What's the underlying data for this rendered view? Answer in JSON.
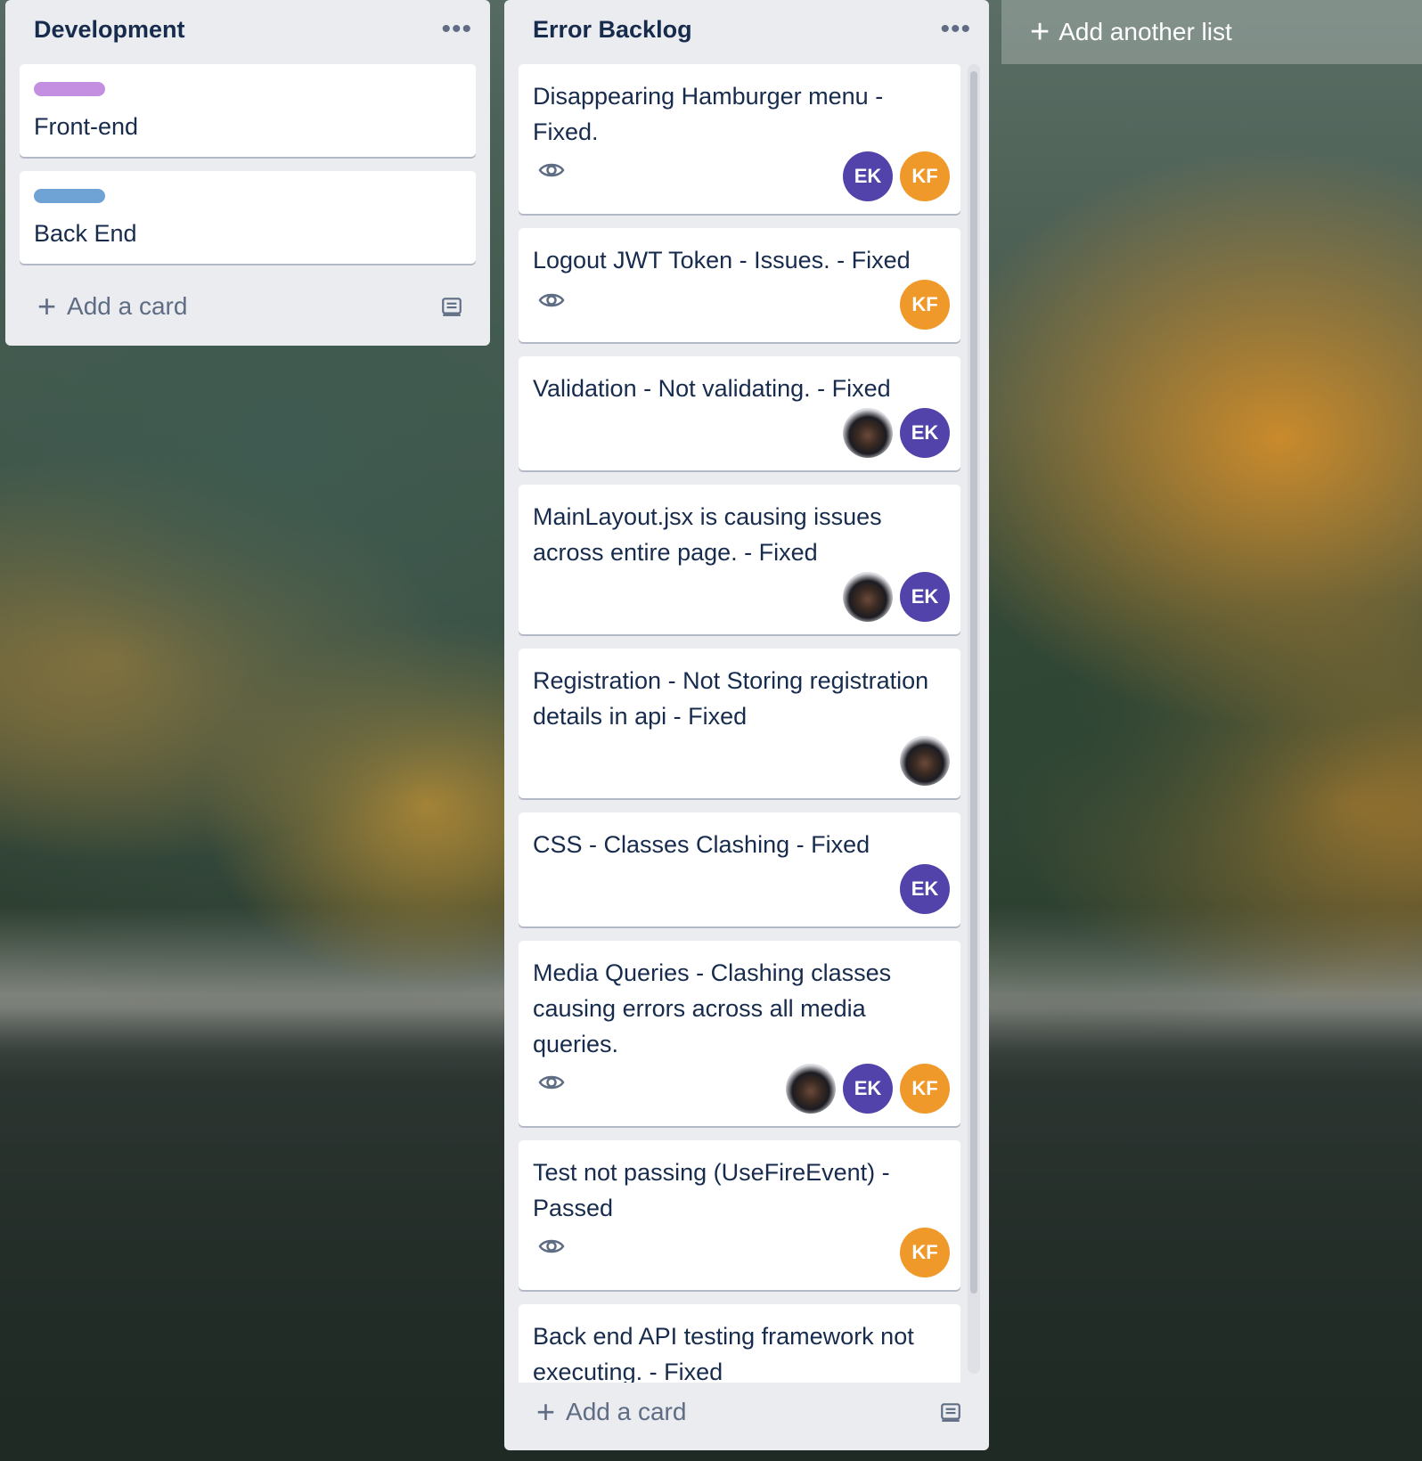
{
  "lists": [
    {
      "title": "Development",
      "cards": [
        {
          "title": "Front-end",
          "label_color": "#c48fe0"
        },
        {
          "title": "Back End",
          "label_color": "#6fa3d6"
        }
      ],
      "add_card_label": "Add a card"
    },
    {
      "title": "Error Backlog",
      "cards": [
        {
          "title": "Disappearing Hamburger menu - Fixed.",
          "watching": true,
          "members": [
            "EK",
            "KF"
          ]
        },
        {
          "title": "Logout JWT Token - Issues. - Fixed",
          "watching": true,
          "members": [
            "KF"
          ]
        },
        {
          "title": "Validation - Not validating. - Fixed",
          "watching": false,
          "members": [
            "photo",
            "EK"
          ]
        },
        {
          "title": "MainLayout.jsx is causing issues across entire page. - Fixed",
          "watching": false,
          "members": [
            "photo",
            "EK"
          ]
        },
        {
          "title": "Registration - Not Storing registration details in api - Fixed",
          "watching": false,
          "members": [
            "photo"
          ]
        },
        {
          "title": "CSS - Classes Clashing - Fixed",
          "watching": false,
          "members": [
            "EK"
          ]
        },
        {
          "title": "Media Queries - Clashing classes causing errors across all media queries.",
          "watching": true,
          "members": [
            "photo",
            "EK",
            "KF"
          ]
        },
        {
          "title": "Test not passing (UseFireEvent) - Passed",
          "watching": true,
          "members": [
            "KF"
          ]
        },
        {
          "title": "Back end API testing framework not executing. - Fixed",
          "watching": false,
          "members": []
        }
      ],
      "add_card_label": "Add a card"
    }
  ],
  "add_list_label": "Add another list",
  "icons": {
    "menu": "more-horizontal-icon",
    "watch": "eye-icon",
    "add": "plus-icon",
    "template": "card-template-icon"
  },
  "colors": {
    "list_bg": "#ebecf0",
    "member_EK": "#5243aa",
    "member_KF": "#f0992b"
  }
}
